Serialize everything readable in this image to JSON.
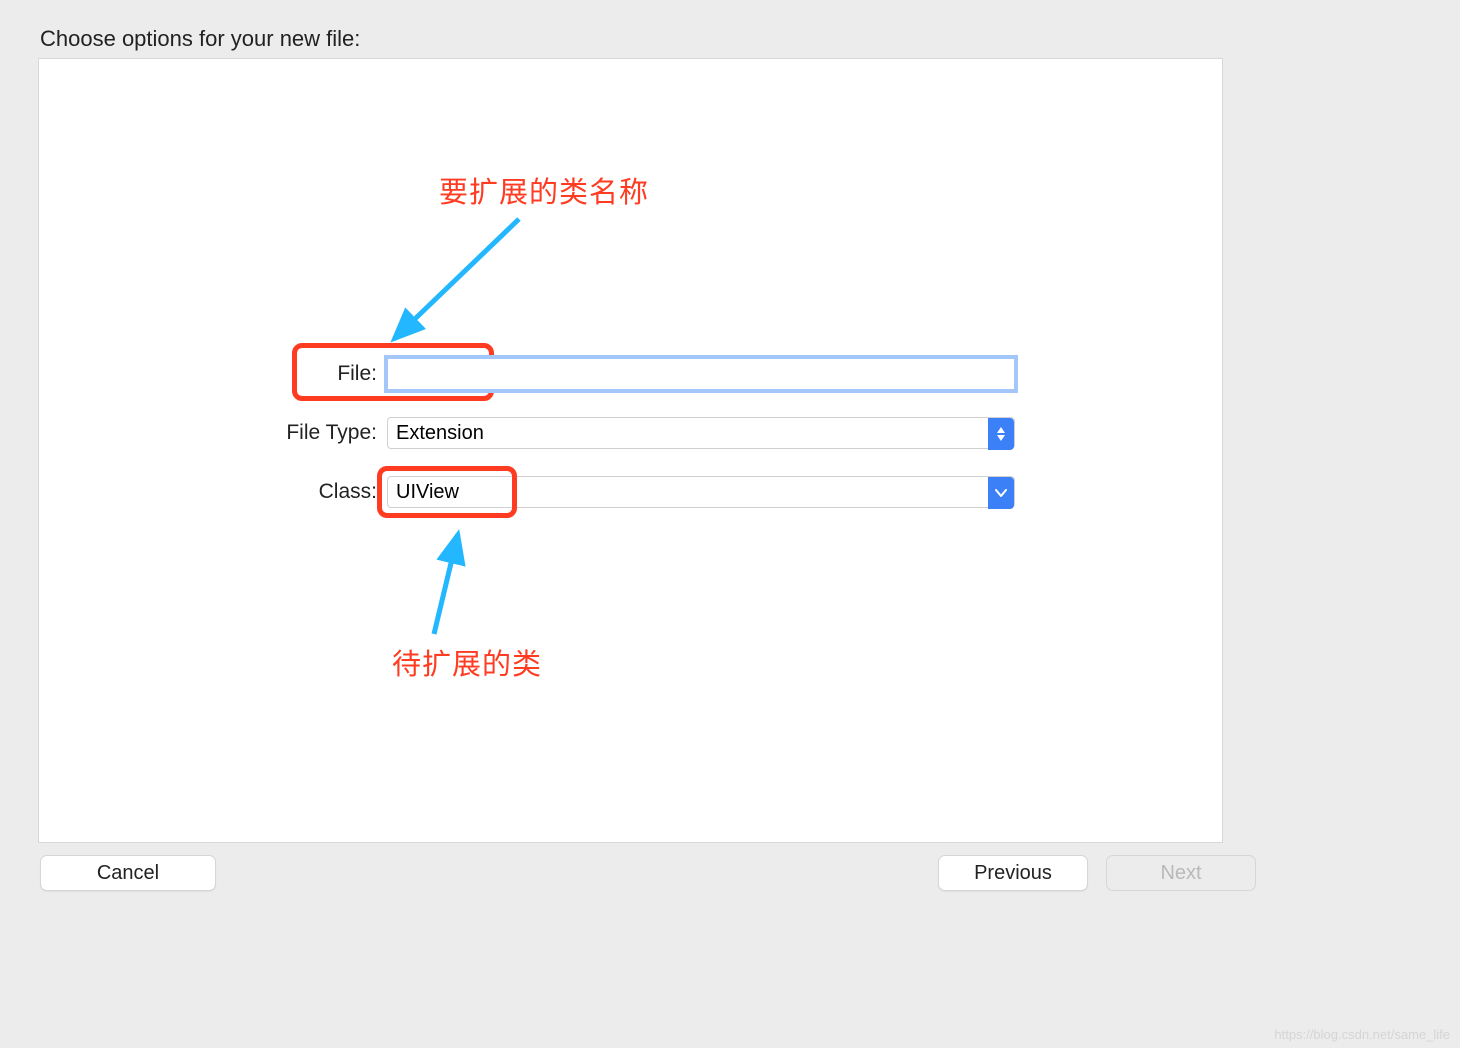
{
  "dialog": {
    "title": "Choose options for your new file:"
  },
  "form": {
    "file": {
      "label": "File:",
      "value": ""
    },
    "fileType": {
      "label": "File Type:",
      "value": "Extension"
    },
    "className": {
      "label": "Class:",
      "value": "UIView"
    }
  },
  "annotations": {
    "top": "要扩展的类名称",
    "bottom": "待扩展的类"
  },
  "buttons": {
    "cancel": "Cancel",
    "previous": "Previous",
    "next": "Next"
  },
  "watermark": "https://blog.csdn.net/same_life"
}
